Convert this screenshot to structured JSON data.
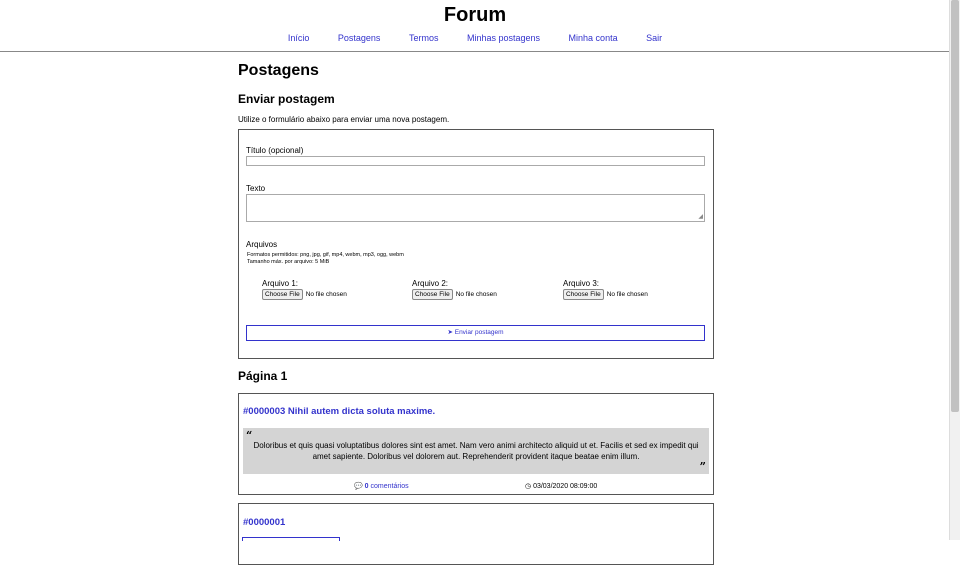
{
  "header": {
    "site_title": "Forum",
    "nav": [
      "Início",
      "Postagens",
      "Termos",
      "Minhas postagens",
      "Minha conta",
      "Sair"
    ]
  },
  "page": {
    "title": "Postagens",
    "form_heading": "Enviar postagem",
    "form_description": "Utilize o formulário abaixo para enviar uma nova postagem.",
    "title_label": "Título (opcional)",
    "title_value": "",
    "text_label": "Texto",
    "text_value": "",
    "files_label": "Arquivos",
    "formats_note": "Formatos permitidos: png, jpg, gif, mp4, webm, mp3, ogg, webm",
    "size_note": "Tamanho máx. por arquivo: 5 MiB",
    "files": [
      {
        "label": "Arquivo 1:",
        "button": "Choose File",
        "status": "No file chosen"
      },
      {
        "label": "Arquivo 2:",
        "button": "Choose File",
        "status": "No file chosen"
      },
      {
        "label": "Arquivo 3:",
        "button": "Choose File",
        "status": "No file chosen"
      }
    ],
    "submit_label": "Enviar postagem",
    "page_heading": "Página 1"
  },
  "posts": [
    {
      "title": "#0000003 Nihil autem dicta soluta maxime.",
      "quote": "Doloribus et quis quasi voluptatibus dolores sint est amet. Nam vero animi architecto aliquid ut et. Facilis et sed ex impedit qui amet sapiente. Doloribus vel dolorem aut. Reprehenderit provident itaque beatae enim illum.",
      "comments_count": "0",
      "comments_label": "comentários",
      "date": "03/03/2020 08:09:00"
    },
    {
      "title": "#0000001"
    }
  ],
  "icons": {
    "send": "paper-plane-icon",
    "comments": "comments-icon",
    "clock": "clock-icon",
    "quote_open": "quote-left-icon",
    "quote_close": "quote-right-icon"
  },
  "colors": {
    "link": "#3333cc",
    "quote_bg": "#d4d4d4",
    "border": "#555555"
  }
}
